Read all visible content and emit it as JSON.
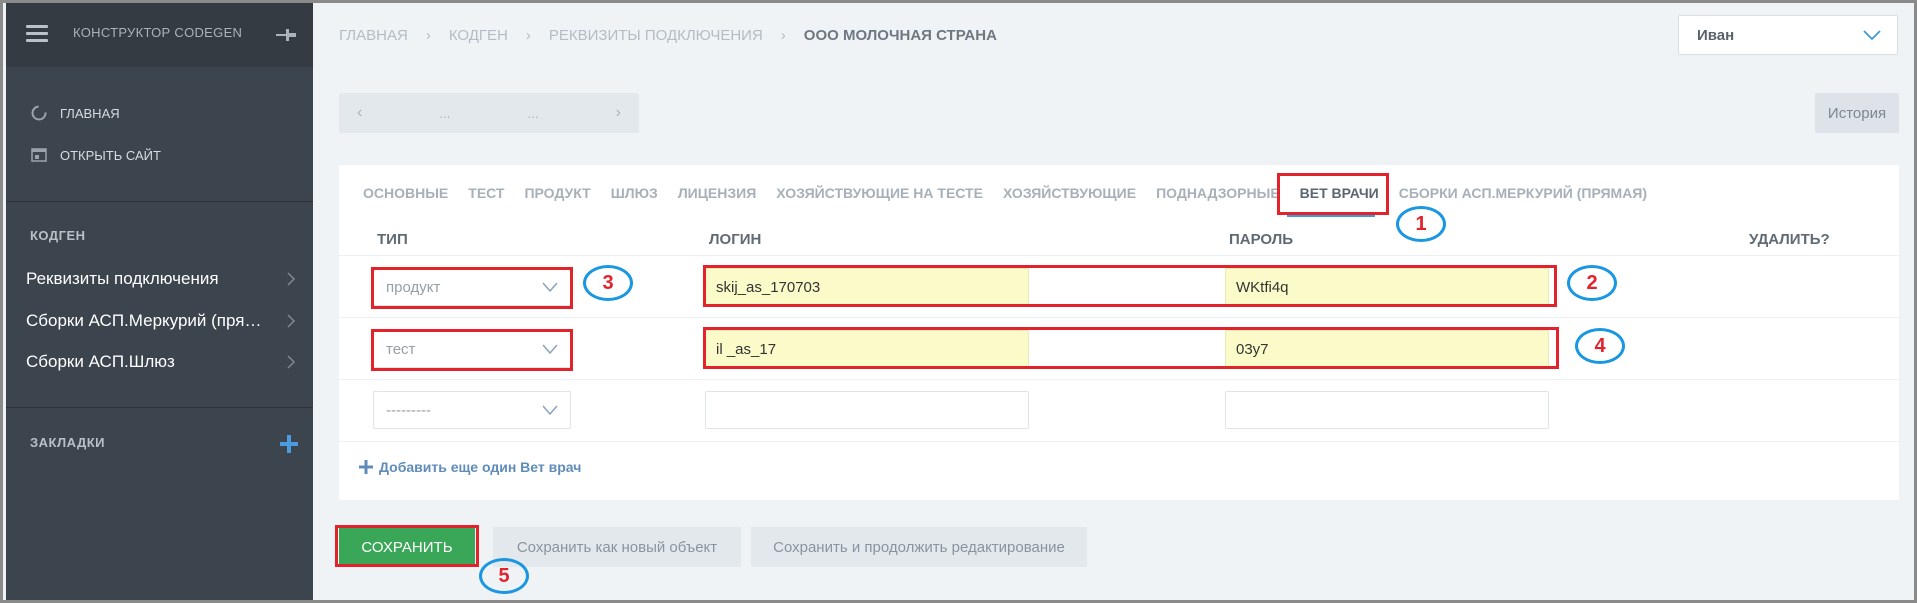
{
  "sidebar": {
    "title": "Конструктор Codegen",
    "links": [
      {
        "label": "Главная",
        "icon": "loading-circle-icon"
      },
      {
        "label": "Открыть сайт",
        "icon": "open-site-icon"
      }
    ],
    "section_codegen": "Кодген",
    "items": [
      {
        "label": "Реквизиты подключения"
      },
      {
        "label": "Сборки АСП.Меркурий (прямая)"
      },
      {
        "label": "Сборки АСП.Шлюз"
      }
    ],
    "section_bookmarks": "Закладки"
  },
  "header": {
    "breadcrumb": [
      "Главная",
      "Кодген",
      "Реквизиты подключения"
    ],
    "breadcrumb_current": "ООО Молочная страна",
    "separator": "›",
    "user": "Иван"
  },
  "pager": {
    "prev": "‹",
    "left_value": "...",
    "right_value": "...",
    "next": "›"
  },
  "history_label": "История",
  "tabs": [
    "Основные",
    "Тест",
    "Продукт",
    "Шлюз",
    "Лицензия",
    "Хозяйствующие на тесте",
    "Хозяйствующие",
    "Поднадзорные",
    "Вет врачи",
    "Сборки АСП.Меркурий (прямая)"
  ],
  "table": {
    "headers": {
      "type": "Тип",
      "login": "Логин",
      "password": "Пароль",
      "delete": "Удалить?"
    },
    "rows": [
      {
        "type": "продукт",
        "login": "skij_as_170703",
        "password": "WKtfi4q"
      },
      {
        "type": "тест",
        "login": "il _as_17",
        "password": "03y7"
      },
      {
        "type": "---------",
        "login": "",
        "password": ""
      }
    ]
  },
  "add_link": "Добавить еще один Вет врач",
  "buttons": {
    "save": "Сохранить",
    "save_new": "Сохранить как новый объект",
    "save_continue": "Сохранить и продолжить редактирование"
  },
  "annotations": [
    "1",
    "2",
    "3",
    "4",
    "5"
  ],
  "colors": {
    "sidebar": "#3c444d",
    "save_green": "#3aa658",
    "highlight_red": "#e3232c",
    "circle_blue": "#1a97e0",
    "autofill_yellow": "#fbfbc9",
    "active_tab_underline": "#3d9cd8"
  }
}
